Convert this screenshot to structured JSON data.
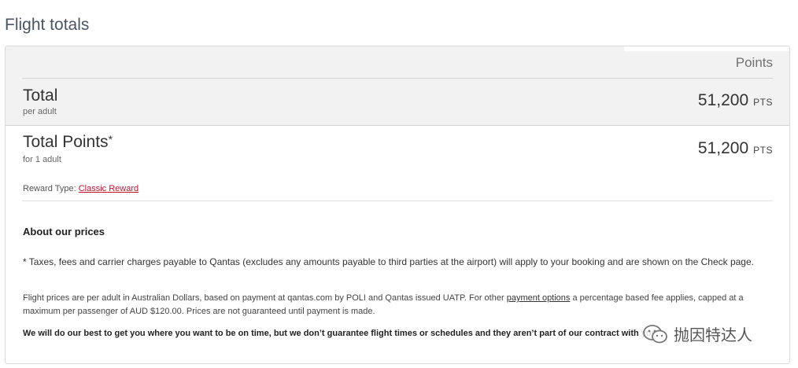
{
  "page": {
    "title": "Flight totals"
  },
  "table": {
    "column_header": "Points",
    "total": {
      "label": "Total",
      "sub": "per adult",
      "value": "51,200",
      "unit": "PTS"
    },
    "total_points": {
      "label": "Total Points",
      "star": "*",
      "sub": "for 1 adult",
      "value": "51,200",
      "unit": "PTS"
    },
    "reward": {
      "prefix": "Reward Type: ",
      "link": "Classic Reward"
    }
  },
  "about": {
    "heading": "About our prices",
    "taxes_note": "* Taxes, fees and carrier charges payable to Qantas (excludes any amounts payable to third parties at the airport) will apply to your booking and are shown on the Check page.",
    "fares_before": "Flight prices are per adult in Australian Dollars, based on payment at qantas.com by POLI and Qantas issued UATP. For other ",
    "fares_link": "payment options",
    "fares_after": " a percentage based fee applies, capped at a maximum per passenger of AUD $120.00. Prices are not guaranteed until payment is made.",
    "schedule_note": "We will do our best to get you where you want to be on time, but we don’t guarantee flight times or schedules and they aren’t part of our contract with you."
  },
  "watermark": {
    "text": "抛因特达人",
    "icon": "wechat-icon"
  },
  "colors": {
    "link_red": "#c8102e",
    "header_bg": "#f2f2f2"
  }
}
